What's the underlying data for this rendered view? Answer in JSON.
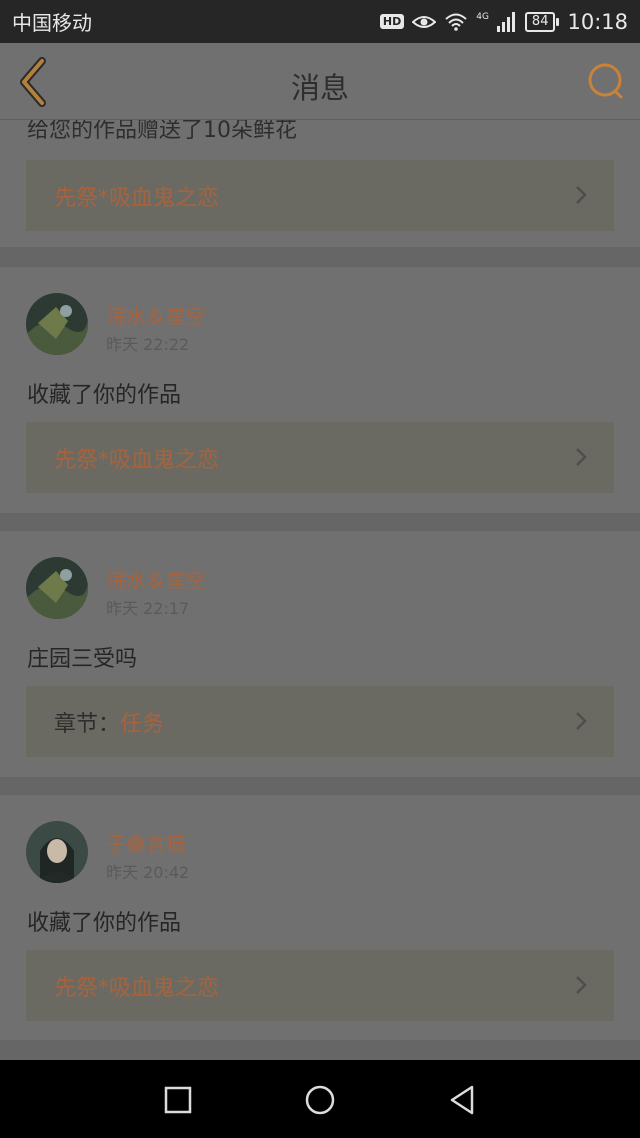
{
  "status_bar": {
    "carrier": "中国移动",
    "hd_badge": "HD",
    "network": "4G",
    "battery": "84",
    "time": "10:18"
  },
  "header": {
    "title": "消息",
    "back_icon": "chevron-left-icon",
    "search_icon": "search-icon",
    "accent_color": "#c8823a"
  },
  "notifications": [
    {
      "partial_text": "给您的作品赠送了10朵鲜花",
      "work_title": "先祭*吸血鬼之恋"
    },
    {
      "username": "浣水＆星空",
      "time": "昨天 22:22",
      "action": "收藏了你的作品",
      "work_title": "先祭*吸血鬼之恋"
    },
    {
      "username": "浣水＆星空",
      "time": "昨天 22:17",
      "action": "庄园三受吗",
      "chapter_prefix": "章节：",
      "chapter_title": "任务"
    },
    {
      "username": "子桑言痕",
      "time": "昨天 20:42",
      "action": "收藏了你的作品",
      "work_title": "先祭*吸血鬼之恋"
    }
  ],
  "nav_bar": {
    "recent_icon": "square-icon",
    "home_icon": "circle-icon",
    "back_icon": "triangle-back-icon"
  }
}
